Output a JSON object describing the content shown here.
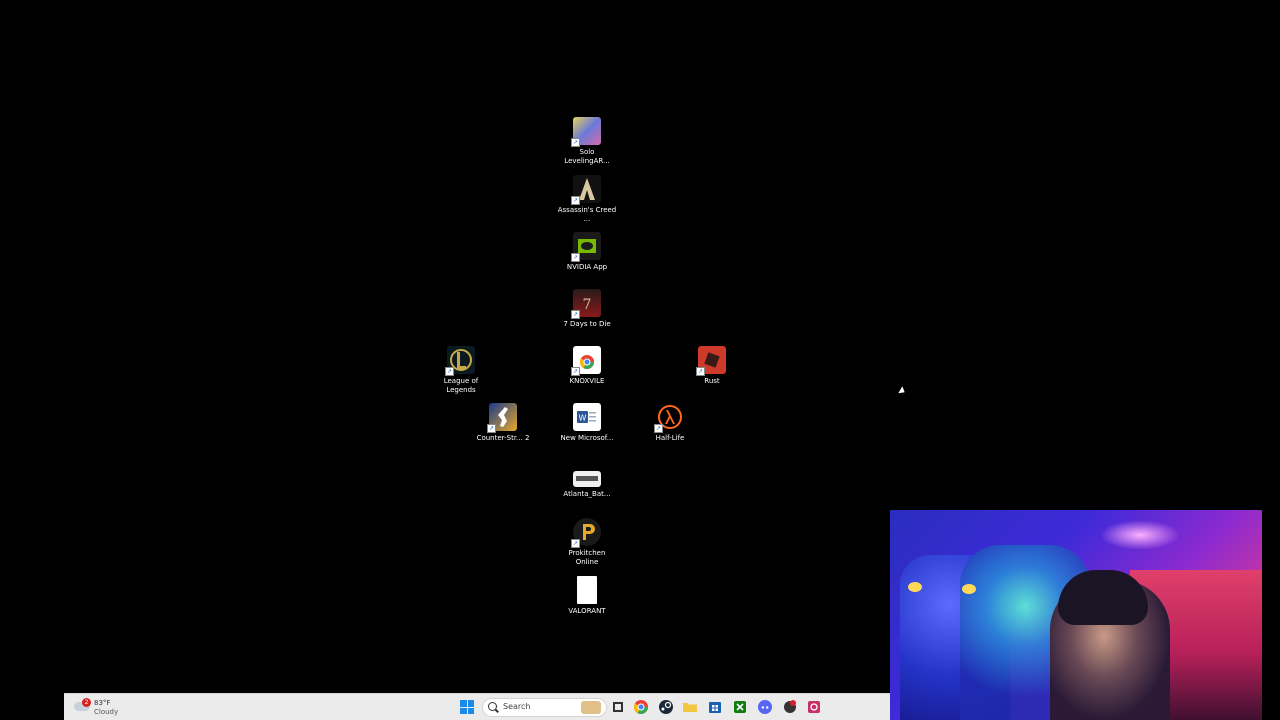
{
  "desktop": {
    "icons": [
      {
        "label": "Solo LevelingAR...",
        "icon": "solo-leveling-icon",
        "color": "#6a7ad8"
      },
      {
        "label": "Assassin's Creed ...",
        "icon": "assassins-creed-icon",
        "color": "#1a1a1a"
      },
      {
        "label": "NVIDIA App",
        "icon": "nvidia-icon",
        "color": "#76b900"
      },
      {
        "label": "7 Days to Die",
        "icon": "seven-days-icon",
        "color": "#8a1a1a"
      },
      {
        "label": "League of Legends",
        "icon": "league-icon",
        "color": "#c8a84a"
      },
      {
        "label": "KNOXVILE",
        "icon": "chrome-shortcut-icon",
        "color": "#ffffff"
      },
      {
        "label": "Rust",
        "icon": "rust-icon",
        "color": "#cd3a2a"
      },
      {
        "label": "Counter-Str... 2",
        "icon": "counter-strike-icon",
        "color": "#e8a92a"
      },
      {
        "label": "New Microsof...",
        "icon": "word-document-icon",
        "color": "#ffffff"
      },
      {
        "label": "Half-Life",
        "icon": "half-life-icon",
        "color": "#ff6a1a"
      },
      {
        "label": "Atlanta_Bat...",
        "icon": "image-file-icon",
        "color": "#f0f0f0"
      },
      {
        "label": "Prokitchen Online",
        "icon": "prokitchen-icon",
        "color": "#e8a82a"
      },
      {
        "label": "VALORANT",
        "icon": "blank-file-icon",
        "color": "#ffffff"
      }
    ]
  },
  "taskbar": {
    "weather": {
      "badge": "2",
      "temp": "83°F",
      "condition": "Cloudy"
    },
    "search_placeholder": "Search",
    "apps": [
      {
        "icon": "chrome-icon",
        "color": "#e84a3a"
      },
      {
        "icon": "steam-icon",
        "color": "#1b2838"
      },
      {
        "icon": "file-explorer-icon",
        "color": "#f2c744"
      },
      {
        "icon": "store-icon",
        "color": "#1a5fb4"
      },
      {
        "icon": "xbox-icon",
        "color": "#107c10"
      },
      {
        "icon": "discord-icon",
        "color": "#5865f2"
      },
      {
        "icon": "app-red-icon",
        "color": "#d82030"
      },
      {
        "icon": "app-pink-icon",
        "color": "#c8306a"
      }
    ],
    "misc_icon": {
      "icon": "task-view-icon",
      "color": "#333333"
    }
  }
}
